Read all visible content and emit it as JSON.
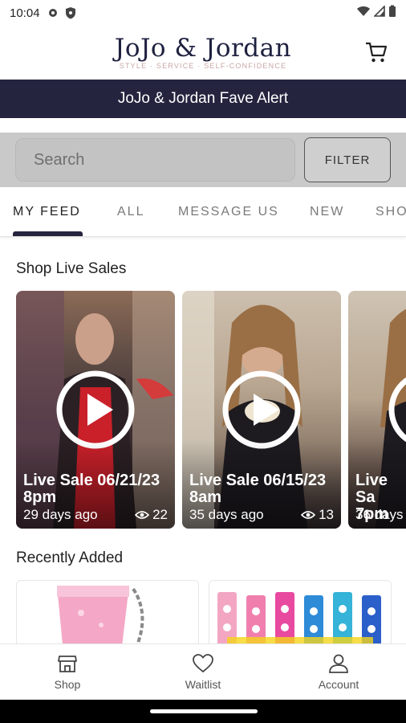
{
  "status_bar": {
    "time": "10:04"
  },
  "header": {
    "logo": "JoJo & Jordan",
    "tagline": "STYLE · SERVICE · SELF-CONFIDENCE"
  },
  "banner": {
    "text": "JoJo & Jordan Fave Alert"
  },
  "search": {
    "placeholder": "Search",
    "filter_label": "FILTER"
  },
  "tabs": [
    "MY FEED",
    "ALL",
    "MESSAGE US",
    "NEW",
    "SHO"
  ],
  "sections": {
    "live": "Shop Live Sales",
    "recent": "Recently Added"
  },
  "live_sales": [
    {
      "title": "Live Sale 06/21/23 8pm",
      "ago": "29 days ago",
      "views": "22"
    },
    {
      "title": "Live Sale 06/15/23 8am",
      "ago": "35 days ago",
      "views": "13"
    },
    {
      "title": "Live Sa 7pm",
      "ago": "36 days",
      "views": ""
    }
  ],
  "bottom_nav": {
    "shop": "Shop",
    "waitlist": "Waitlist",
    "account": "Account"
  },
  "colors": {
    "brand_navy": "#24243f",
    "tagline_pink": "#c9a6a6"
  }
}
